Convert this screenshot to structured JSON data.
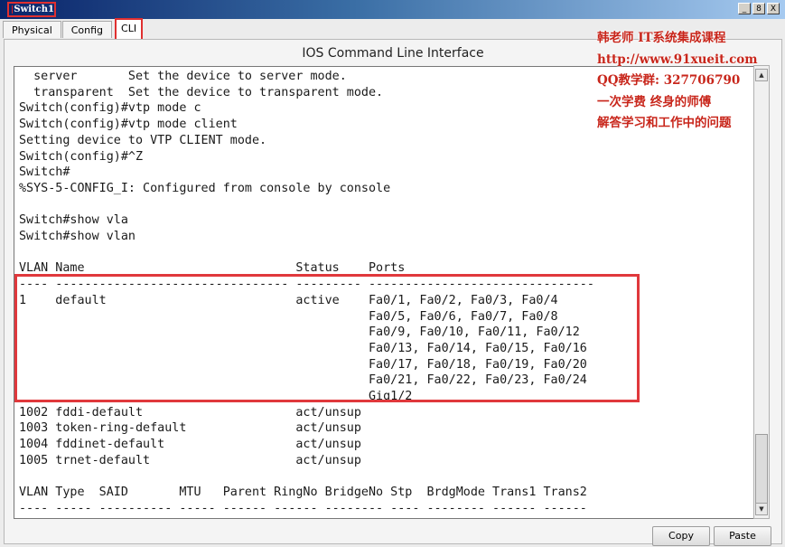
{
  "window": {
    "title": "Switch1",
    "buttons": {
      "minimize": "_",
      "maximize": "8",
      "close": "X"
    }
  },
  "tabs": [
    {
      "label": "Physical"
    },
    {
      "label": "Config"
    },
    {
      "label": "CLI",
      "active": true
    }
  ],
  "panel": {
    "heading": "IOS Command Line Interface"
  },
  "terminal": {
    "lines": [
      "  server       Set the device to server mode.",
      "  transparent  Set the device to transparent mode.",
      "Switch(config)#vtp mode c",
      "Switch(config)#vtp mode client",
      "Setting device to VTP CLIENT mode.",
      "Switch(config)#^Z",
      "Switch#",
      "%SYS-5-CONFIG_I: Configured from console by console",
      "",
      "Switch#show vla",
      "Switch#show vlan",
      "",
      "VLAN Name                             Status    Ports",
      "---- -------------------------------- --------- -------------------------------",
      "1    default                          active    Fa0/1, Fa0/2, Fa0/3, Fa0/4",
      "                                                Fa0/5, Fa0/6, Fa0/7, Fa0/8",
      "                                                Fa0/9, Fa0/10, Fa0/11, Fa0/12",
      "                                                Fa0/13, Fa0/14, Fa0/15, Fa0/16",
      "                                                Fa0/17, Fa0/18, Fa0/19, Fa0/20",
      "                                                Fa0/21, Fa0/22, Fa0/23, Fa0/24",
      "                                                Gig1/2",
      "1002 fddi-default                     act/unsup",
      "1003 token-ring-default               act/unsup",
      "1004 fddinet-default                  act/unsup",
      "1005 trnet-default                    act/unsup",
      "",
      "VLAN Type  SAID       MTU   Parent RingNo BridgeNo Stp  BrdgMode Trans1 Trans2",
      "---- ----- ---------- ----- ------ ------ -------- ---- -------- ------ ------"
    ]
  },
  "overlay_text": [
    "韩老师  IT系统集成课程",
    "http://www.91xueit.com",
    "QQ教学群: 327706790",
    "一次学费  终身的师傅",
    "解答学习和工作中的问题"
  ],
  "actions": {
    "copy_label": "Copy",
    "paste_label": "Paste"
  },
  "colors": {
    "annotation_red": "#e0383c",
    "titlebar": "#0a246a"
  }
}
